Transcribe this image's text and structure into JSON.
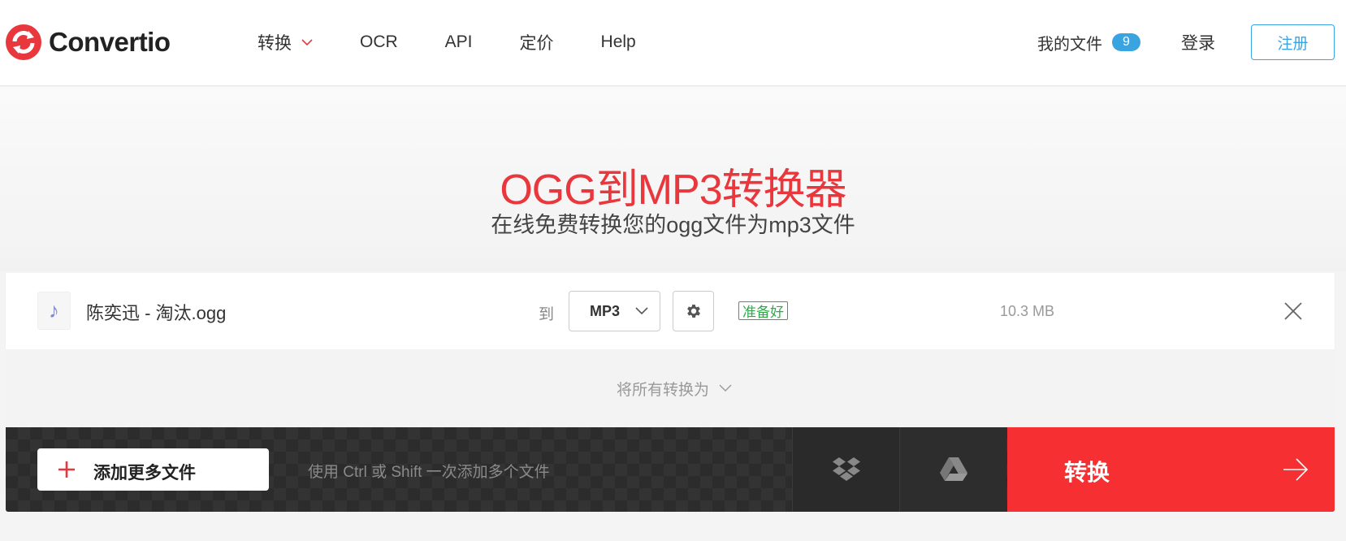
{
  "header": {
    "logo_text": "Convertio",
    "nav": [
      {
        "label": "转换",
        "has_dropdown": true
      },
      {
        "label": "OCR"
      },
      {
        "label": "API"
      },
      {
        "label": "定价"
      },
      {
        "label": "Help"
      }
    ],
    "my_files_label": "我的文件",
    "my_files_count": "9",
    "login_label": "登录",
    "signup_label": "注册"
  },
  "hero": {
    "title": "OGG到MP3转换器",
    "subtitle": "在线免费转换您的ogg文件为mp3文件"
  },
  "file": {
    "icon": "music-note-icon",
    "name": "陈奕迅 - 淘汰.ogg",
    "to_label": "到",
    "format": "MP3",
    "status": "准备好",
    "size": "10.3 MB"
  },
  "convert_all_label": "将所有转换为",
  "bottom": {
    "add_files_label": "添加更多文件",
    "hint": "使用 Ctrl 或 Shift 一次添加多个文件",
    "convert_label": "转换"
  },
  "colors": {
    "brand_red": "#f52f32",
    "title_red": "#e8383d",
    "accent_blue": "#3aa4e0",
    "ready_green": "#2eaa4a"
  }
}
